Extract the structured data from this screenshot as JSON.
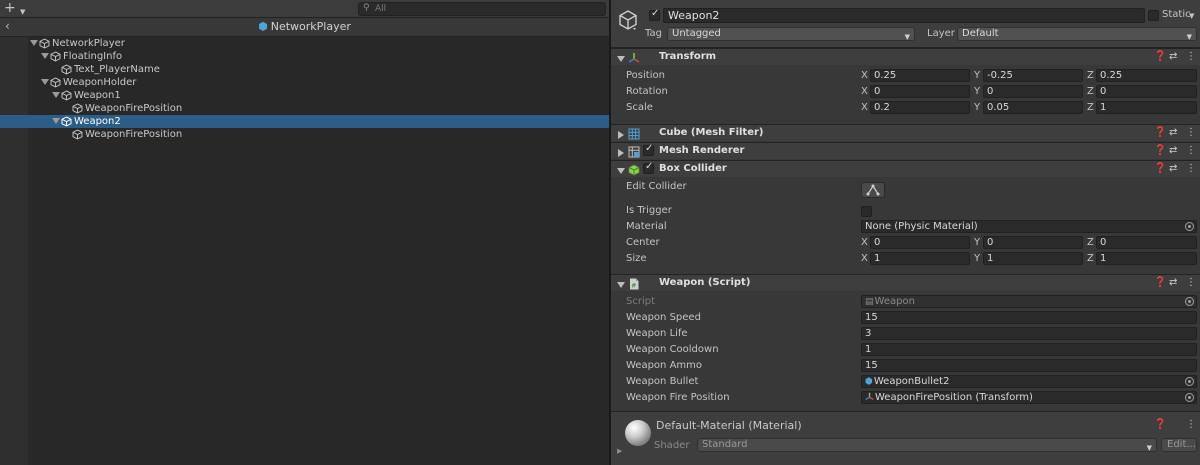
{
  "hierarchy": {
    "search_placeholder": "All",
    "scene_title": "NetworkPlayer",
    "items": [
      {
        "label": "NetworkPlayer",
        "depth": 0,
        "expanded": true,
        "selected": false
      },
      {
        "label": "FloatingInfo",
        "depth": 1,
        "expanded": true,
        "selected": false
      },
      {
        "label": "Text_PlayerName",
        "depth": 2,
        "expanded": null,
        "selected": false
      },
      {
        "label": "WeaponHolder",
        "depth": 1,
        "expanded": true,
        "selected": false
      },
      {
        "label": "Weapon1",
        "depth": 2,
        "expanded": true,
        "selected": false
      },
      {
        "label": "WeaponFirePosition",
        "depth": 3,
        "expanded": null,
        "selected": false
      },
      {
        "label": "Weapon2",
        "depth": 2,
        "expanded": true,
        "selected": true
      },
      {
        "label": "WeaponFirePosition",
        "depth": 3,
        "expanded": null,
        "selected": false
      }
    ]
  },
  "inspector": {
    "object_name": "Weapon2",
    "static_label": "Static",
    "tag_label": "Tag",
    "tag_value": "Untagged",
    "layer_label": "Layer",
    "layer_value": "Default",
    "transform": {
      "title": "Transform",
      "position": {
        "label": "Position",
        "x": "0.25",
        "y": "-0.25",
        "z": "0.25"
      },
      "rotation": {
        "label": "Rotation",
        "x": "0",
        "y": "0",
        "z": "0"
      },
      "scale": {
        "label": "Scale",
        "x": "0.2",
        "y": "0.05",
        "z": "1"
      }
    },
    "mesh_filter": {
      "title": "Cube (Mesh Filter)"
    },
    "mesh_renderer": {
      "title": "Mesh Renderer"
    },
    "box_collider": {
      "title": "Box Collider",
      "edit_collider_label": "Edit Collider",
      "is_trigger_label": "Is Trigger",
      "material_label": "Material",
      "material_value": "None (Physic Material)",
      "center": {
        "label": "Center",
        "x": "0",
        "y": "0",
        "z": "0"
      },
      "size": {
        "label": "Size",
        "x": "1",
        "y": "1",
        "z": "1"
      }
    },
    "weapon_script": {
      "title": "Weapon (Script)",
      "script_label": "Script",
      "script_value": "Weapon",
      "fields": [
        {
          "label": "Weapon Speed",
          "value": "15"
        },
        {
          "label": "Weapon Life",
          "value": "3"
        },
        {
          "label": "Weapon Cooldown",
          "value": "1"
        },
        {
          "label": "Weapon Ammo",
          "value": "15"
        }
      ],
      "bullet_label": "Weapon Bullet",
      "bullet_value": "WeaponBullet2",
      "fire_position_label": "Weapon Fire Position",
      "fire_position_value": "WeaponFirePosition (Transform)"
    },
    "material": {
      "title": "Default-Material (Material)",
      "shader_label": "Shader",
      "shader_value": "Standard",
      "edit_label": "Edit..."
    },
    "axis_letters": {
      "x": "X",
      "y": "Y",
      "z": "Z"
    }
  },
  "colors": {
    "selection": "#2c5d87",
    "prefab_cube": "#4fa3d8",
    "transform_red": "#d9483b",
    "transform_green": "#8fc73e",
    "transform_blue": "#3a7fd8",
    "collider_green": "#8fd14f"
  }
}
